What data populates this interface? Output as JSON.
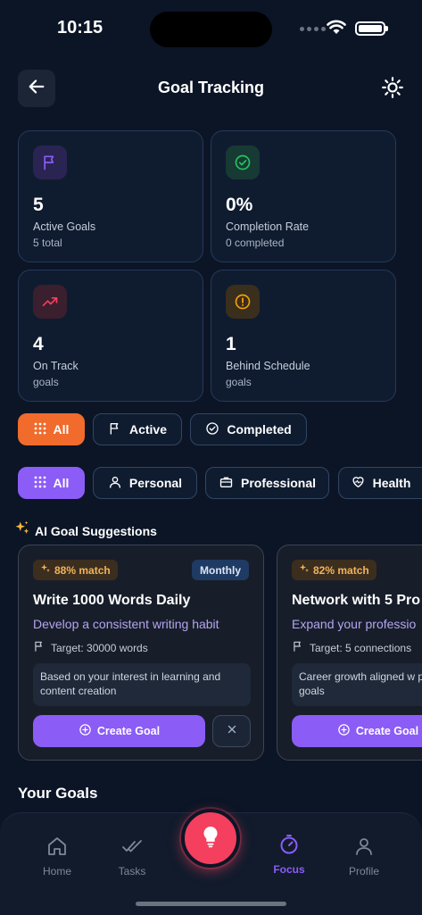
{
  "status_bar": {
    "time": "10:15"
  },
  "header": {
    "title": "Goal Tracking"
  },
  "stats": [
    {
      "value": "5",
      "label": "Active Goals",
      "sub": "5 total",
      "icon": "flag-icon",
      "icon_color": "#8b5cf6"
    },
    {
      "value": "0%",
      "label": "Completion Rate",
      "sub": "0 completed",
      "icon": "check-circle-icon",
      "icon_color": "#22c55e"
    },
    {
      "value": "4",
      "label": "On Track",
      "sub": "goals",
      "icon": "trending-up-icon",
      "icon_color": "#f43f5e"
    },
    {
      "value": "1",
      "label": "Behind Schedule",
      "sub": "goals",
      "icon": "alert-circle-icon",
      "icon_color": "#f59e0b"
    }
  ],
  "status_filters": {
    "all": "All",
    "active": "Active",
    "completed": "Completed",
    "selected": "All"
  },
  "category_filters": {
    "all": "All",
    "personal": "Personal",
    "professional": "Professional",
    "health": "Health",
    "selected": "All"
  },
  "suggestions": {
    "title": "AI Goal Suggestions",
    "items": [
      {
        "match": "88% match",
        "period": "Monthly",
        "title": "Write 1000 Words Daily",
        "description": "Develop a consistent writing habit",
        "target": "Target: 30000 words",
        "reason": "Based on your interest in learning and content creation",
        "create_label": "Create Goal"
      },
      {
        "match": "82% match",
        "title": "Network with 5 Pro",
        "description": "Expand your professio",
        "target": "Target: 5 connections",
        "reason": "Career growth aligned w professional goals",
        "create_label": "Create Goal"
      }
    ]
  },
  "your_goals": {
    "title": "Your Goals"
  },
  "nav": {
    "home": "Home",
    "tasks": "Tasks",
    "focus": "Focus",
    "profile": "Profile",
    "active": "Focus"
  },
  "colors": {
    "background": "#0b1526",
    "accent": "#8b5cf6",
    "orange": "#f06b2c",
    "fab": "#f43f5e"
  }
}
